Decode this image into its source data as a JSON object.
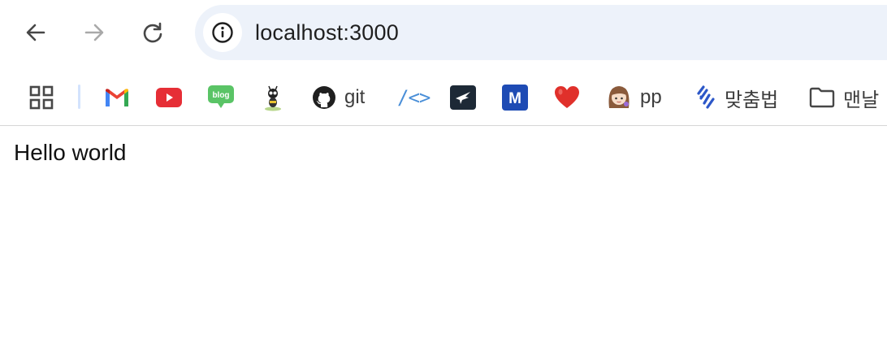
{
  "browser": {
    "url": "localhost:3000",
    "nav": {
      "back_icon": "arrow-left-icon",
      "forward_icon": "arrow-right-icon",
      "reload_icon": "reload-icon",
      "site_info_icon": "info-icon"
    }
  },
  "bookmarks": [
    {
      "icon": "apps-grid-icon",
      "label": ""
    },
    {
      "icon": "gmail-icon",
      "label": ""
    },
    {
      "icon": "youtube-icon",
      "label": ""
    },
    {
      "icon": "naver-blog-icon",
      "label": "",
      "badge": "blog"
    },
    {
      "icon": "ant-character-icon",
      "label": ""
    },
    {
      "icon": "github-icon",
      "label": "git"
    },
    {
      "icon": "code-brackets-icon",
      "label": "",
      "glyph": "/<>"
    },
    {
      "icon": "bird-app-icon",
      "label": ""
    },
    {
      "icon": "m-app-icon",
      "label": "",
      "badge": "M"
    },
    {
      "icon": "heart-icon",
      "label": ""
    },
    {
      "icon": "avatar-girl-icon",
      "label": "pp"
    },
    {
      "icon": "spellcheck-icon",
      "label": "맞춤법"
    },
    {
      "icon": "folder-icon",
      "label": "맨날"
    }
  ],
  "colors": {
    "omnibox_bg": "#edf2fa",
    "icon_gray": "#474747",
    "youtube_red": "#e62e36",
    "naver_green": "#5ac466",
    "heart_red": "#e0302b",
    "m_blue": "#1e4bb4"
  },
  "page": {
    "content_text": "Hello world"
  }
}
